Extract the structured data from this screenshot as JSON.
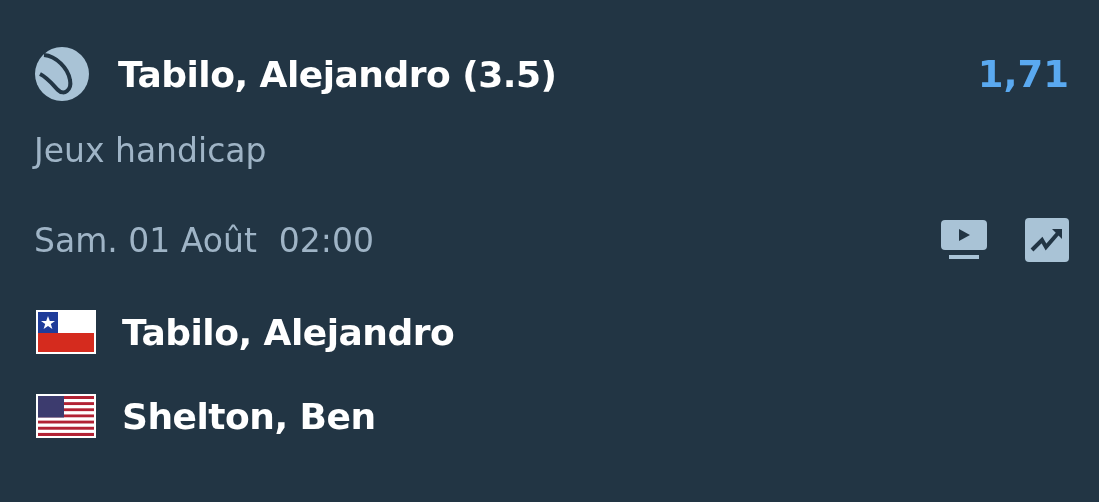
{
  "selection": {
    "name": "Tabilo, Alejandro (3.5)",
    "odds": "1,71",
    "market": "Jeux handicap"
  },
  "event": {
    "date": "Sam. 01 Août",
    "time": "02:00"
  },
  "players": [
    {
      "name": "Tabilo, Alejandro",
      "kind": "chile"
    },
    {
      "name": "Shelton, Ben",
      "kind": "usa"
    }
  ]
}
